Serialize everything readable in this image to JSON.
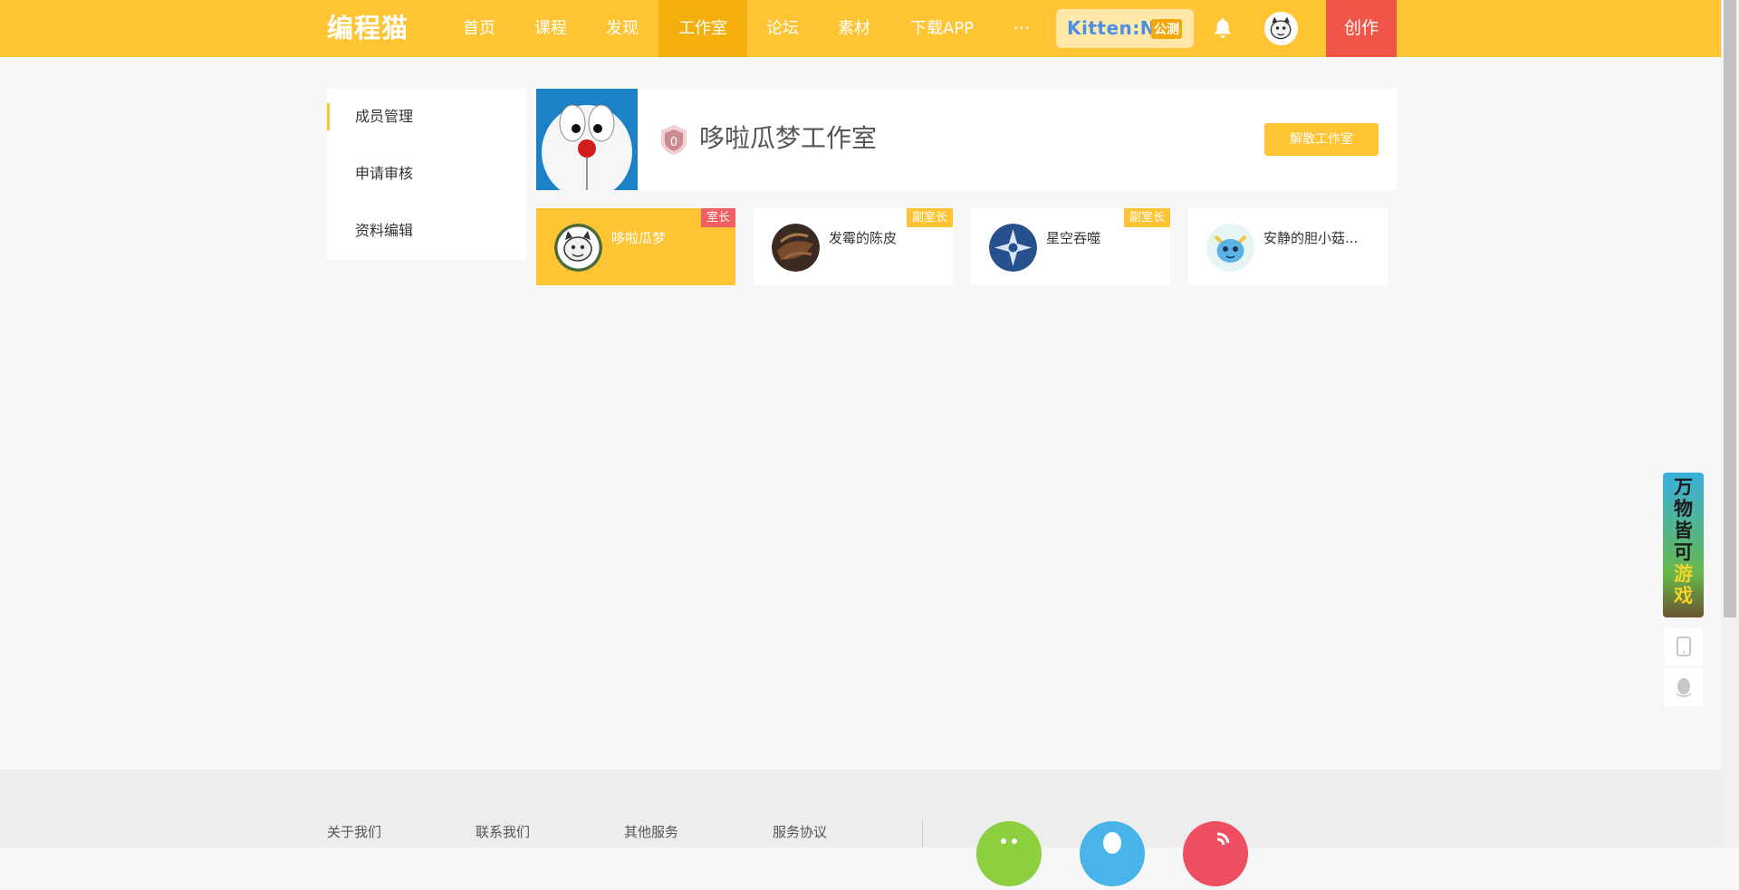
{
  "nav": {
    "logo": "编程猫",
    "items": [
      "首页",
      "课程",
      "发现",
      "工作室",
      "论坛",
      "素材",
      "下载APP"
    ],
    "more_label": "···",
    "kitten_text": "Kitten:N",
    "kitten_tag": "公测",
    "create_label": "创作",
    "colors": {
      "bar": "#fec433",
      "active": "#f4af0d",
      "create": "#f15448"
    }
  },
  "sidebar": {
    "items": [
      {
        "label": "成员管理"
      },
      {
        "label": "申请审核"
      },
      {
        "label": "资料编辑"
      }
    ]
  },
  "studio": {
    "level": "0",
    "name": "哆啦瓜梦工作室",
    "dissolve_label": "解散工作室"
  },
  "members": [
    {
      "name": "哆啦瓜梦",
      "role": "室长"
    },
    {
      "name": "发霉的陈皮",
      "role": "副室长"
    },
    {
      "name": "星空吞噬",
      "role": "副室长"
    },
    {
      "name": "安静的胆小菇...",
      "role": ""
    }
  ],
  "float": {
    "banner_text": [
      "万",
      "物",
      "皆",
      "可",
      "游",
      "戏"
    ]
  },
  "footer": {
    "links": [
      "关于我们",
      "联系我们",
      "其他服务",
      "服务协议"
    ],
    "circle_colors": [
      "#8ccf3f",
      "#49b4ea",
      "#ee4d62"
    ]
  }
}
